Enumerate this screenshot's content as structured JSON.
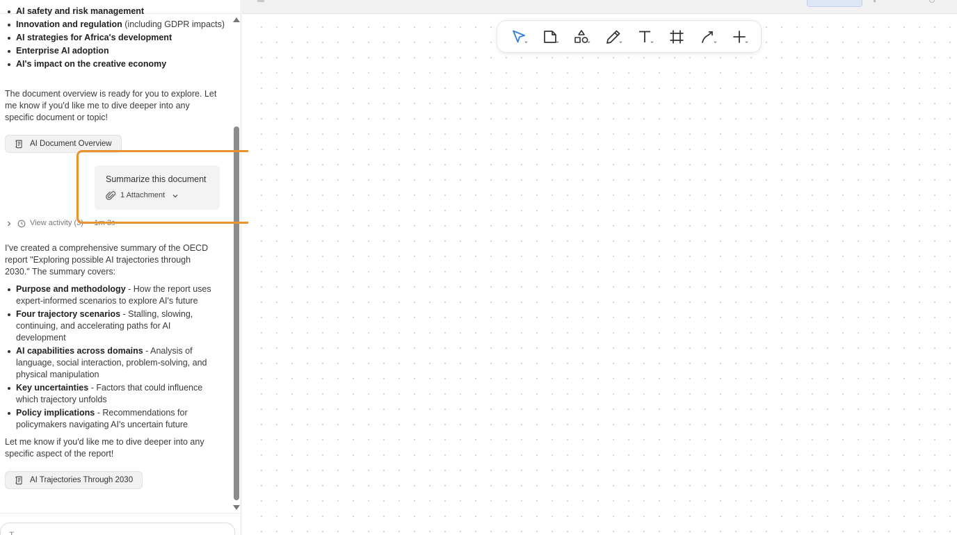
{
  "chat": {
    "list1": [
      {
        "bold": "AI safety and risk management",
        "rest": ""
      },
      {
        "bold": "Innovation and regulation",
        "rest": " (including GDPR impacts)"
      },
      {
        "bold": "AI strategies for Africa's development",
        "rest": ""
      },
      {
        "bold": "Enterprise AI adoption",
        "rest": ""
      },
      {
        "bold": "AI's impact on the creative economy",
        "rest": ""
      }
    ],
    "para1": "The document overview is ready for you to explore. Let me know if you'd like me to dive deeper into any specific document or topic!",
    "chip1": "AI Document Overview",
    "user_message": "Summarize this document",
    "attachment_label": "1 Attachment",
    "activity_label": "View activity (3)",
    "activity_time": "1m 3s",
    "para2": "I've created a comprehensive summary of the OECD report \"Exploring possible AI trajectories through 2030.\" The summary covers:",
    "list2": [
      {
        "bold": "Purpose and methodology",
        "rest": " - How the report uses expert-informed scenarios to explore AI's future"
      },
      {
        "bold": "Four trajectory scenarios",
        "rest": " - Stalling, slowing, continuing, and accelerating paths for AI development"
      },
      {
        "bold": "AI capabilities across domains",
        "rest": " - Analysis of language, social interaction, problem-solving, and physical manipulation"
      },
      {
        "bold": "Key uncertainties",
        "rest": " - Factors that could influence which trajectory unfolds"
      },
      {
        "bold": "Policy implications",
        "rest": " - Recommendations for policymakers navigating AI's uncertain future"
      }
    ],
    "para3": "Let me know if you'd like me to dive deeper into any specific aspect of the report!",
    "chip2": "AI Trajectories Through 2030",
    "input_placeholder": "T"
  },
  "toolbar": {
    "tools": [
      {
        "id": "select",
        "icon": "cursor-icon",
        "active": true
      },
      {
        "id": "page",
        "icon": "page-icon"
      },
      {
        "id": "shapes",
        "icon": "shapes-icon"
      },
      {
        "id": "pen",
        "icon": "pen-icon"
      },
      {
        "id": "text",
        "icon": "text-icon"
      },
      {
        "id": "frame",
        "icon": "frame-icon"
      },
      {
        "id": "connector",
        "icon": "connector-icon"
      },
      {
        "id": "add",
        "icon": "plus-icon"
      }
    ]
  },
  "colors": {
    "highlight": "#e9922f",
    "accent": "#2f7fd9"
  }
}
